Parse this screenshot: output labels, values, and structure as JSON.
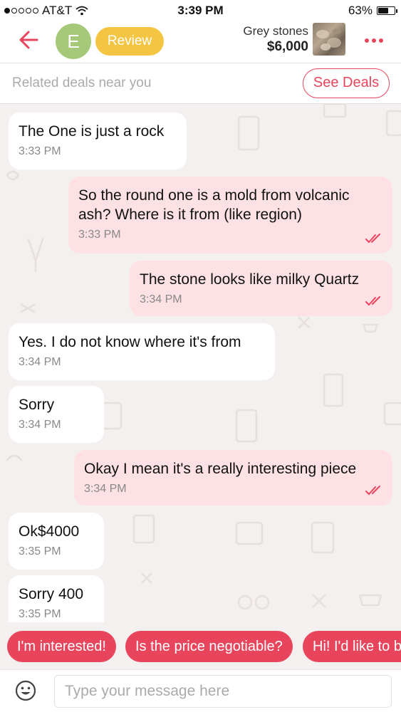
{
  "status_bar": {
    "carrier": "AT&T",
    "time": "3:39 PM",
    "battery": "63%",
    "battery_level": 0.63
  },
  "header": {
    "avatar_letter": "E",
    "review_label": "Review",
    "product_name": "Grey stones",
    "product_price": "$6,000",
    "icons": {
      "back": "arrow-left-icon",
      "more": "more-dots-icon"
    },
    "accent_color": "#e8455d",
    "review_color": "#f4c542",
    "avatar_color": "#a5c979"
  },
  "deals_bar": {
    "text": "Related deals near you",
    "button_label": "See Deals"
  },
  "messages": [
    {
      "direction": "in",
      "text": "The One is just a rock",
      "time": "3:33 PM"
    },
    {
      "direction": "out",
      "text": "So the round one is a mold from volcanic ash? Where is it from (like region)",
      "time": "3:33 PM",
      "read": true
    },
    {
      "direction": "out",
      "text": "The stone looks like milky Quartz",
      "time": "3:34 PM",
      "read": true
    },
    {
      "direction": "in",
      "text": "Yes. I do not know where it's from",
      "time": "3:34 PM"
    },
    {
      "direction": "in",
      "text": "Sorry",
      "time": "3:34 PM"
    },
    {
      "direction": "out",
      "text": "Okay I mean it's a really interesting piece",
      "time": "3:34 PM",
      "read": true
    },
    {
      "direction": "in",
      "text": "Ok$4000",
      "time": "3:35 PM"
    },
    {
      "direction": "in",
      "text": "Sorry 400",
      "time": "3:35 PM"
    }
  ],
  "quick_replies": [
    "I'm interested!",
    "Is the price negotiable?",
    "Hi! I'd like to b"
  ],
  "input": {
    "placeholder": "Type your message here",
    "value": "",
    "emoji_icon": "emoji-smile-icon"
  }
}
